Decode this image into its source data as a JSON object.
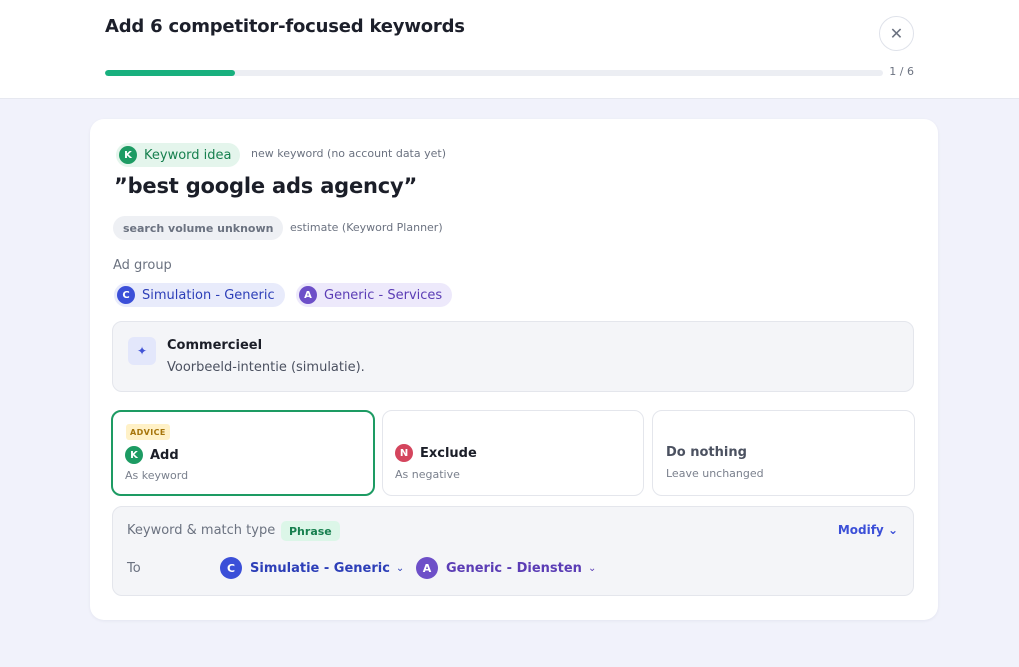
{
  "header": {
    "title": "Add 6 competitor-focused keywords",
    "close_icon": "close-icon",
    "progress": {
      "current": 1,
      "total": 6,
      "label": "1 / 6"
    }
  },
  "card": {
    "keyword_badge": {
      "letter": "K",
      "label": "Keyword idea"
    },
    "keyword_note": "new keyword (no account data yet)",
    "keyword": "”best google ads agency”",
    "volume_badge": "search volume unknown",
    "volume_note": "estimate (Keyword Planner)",
    "ad_group_label": "Ad group",
    "ad_groups": [
      {
        "letter": "C",
        "label": "Simulation - Generic"
      },
      {
        "letter": "A",
        "label": "Generic - Services"
      }
    ],
    "intent": {
      "icon": "sparkle-icon",
      "title": "Commercieel",
      "description": "Voorbeeld-intentie (simulatie)."
    },
    "options": [
      {
        "badge": "ADVICE",
        "letter": "K",
        "title": "Add",
        "subtitle": "As keyword",
        "selected": true
      },
      {
        "letter": "N",
        "title": "Exclude",
        "subtitle": "As negative"
      },
      {
        "title": "Do nothing",
        "subtitle": "Leave unchanged"
      }
    ],
    "match": {
      "label": "Keyword & match type",
      "type": "Phrase",
      "modify_label": "Modify",
      "to_label": "To",
      "targets": [
        {
          "letter": "C",
          "label": "Simulatie - Generic"
        },
        {
          "letter": "A",
          "label": "Generic - Diensten"
        }
      ]
    }
  },
  "colors": {
    "accent_green": "#18b07e",
    "accent_blue": "#3b4fd8",
    "accent_purple": "#6d4fc8",
    "exclude_red": "#d4455d",
    "advice_yellow": "#fff1c7"
  }
}
